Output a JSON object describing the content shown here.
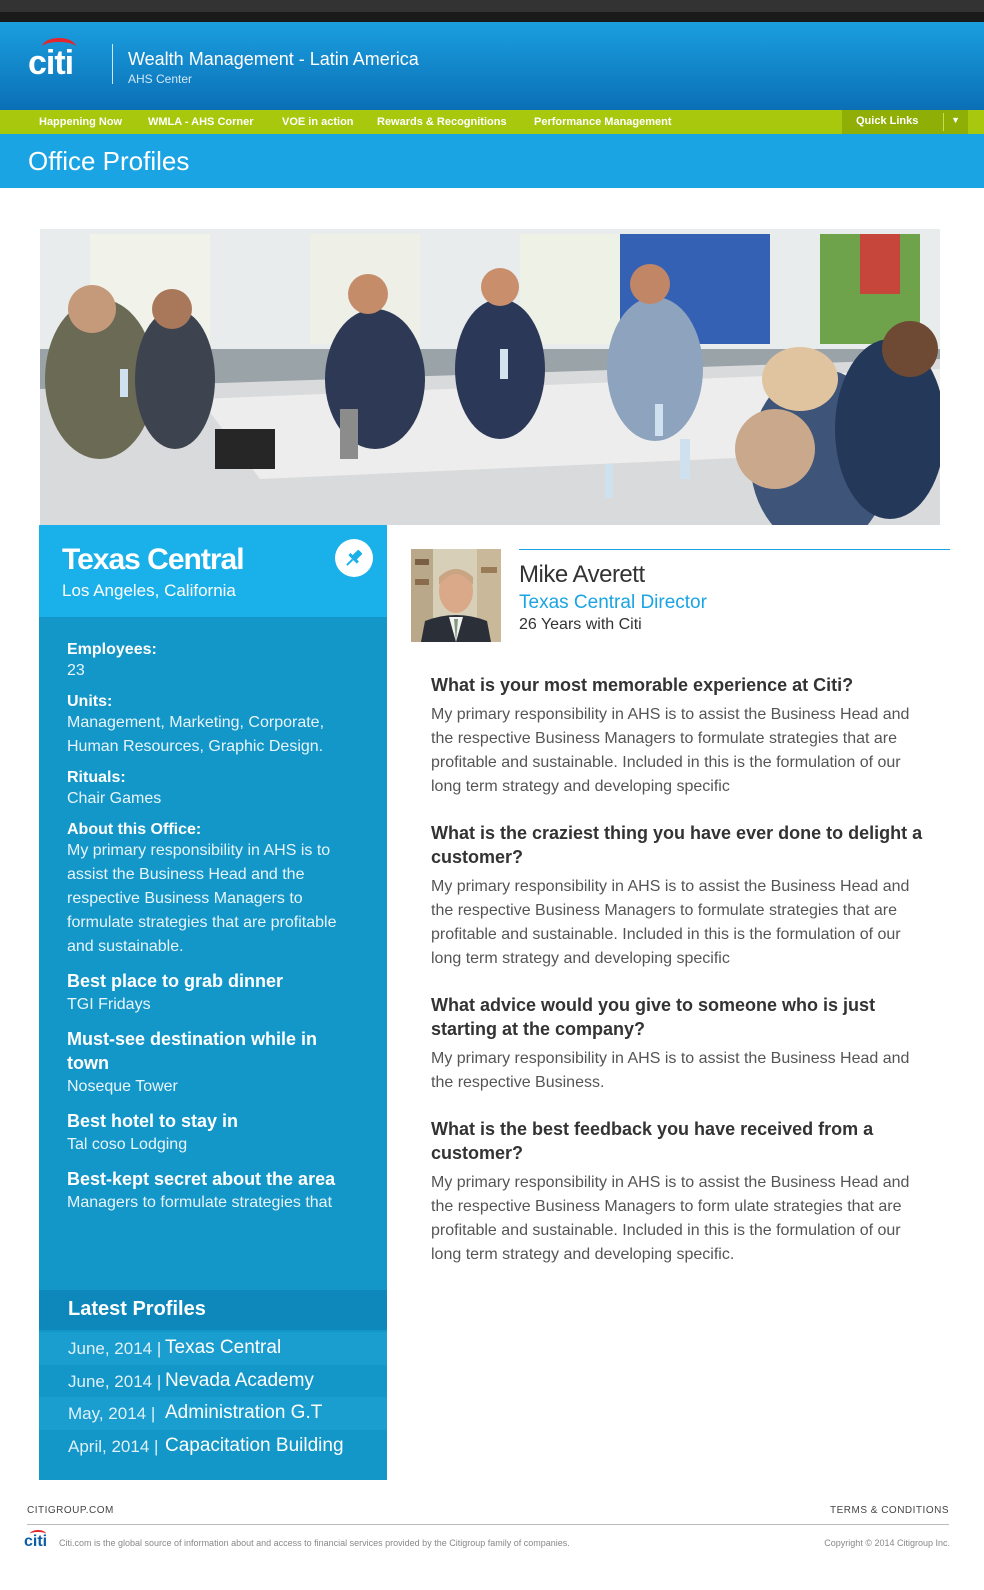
{
  "header": {
    "brand": "citi",
    "title": "Wealth Management - Latin America",
    "subtitle": "AHS Center"
  },
  "nav": {
    "items": [
      "Happening Now",
      "WMLA - AHS Corner",
      "VOE in action",
      "Rewards & Recognitions",
      "Performance Management"
    ],
    "quick_links": "Quick Links"
  },
  "page": {
    "title": "Office Profiles"
  },
  "office": {
    "name": "Texas Central",
    "location": "Los Angeles, California",
    "employees_label": "Employees:",
    "employees": "23",
    "units_label": "Units:",
    "units": "Management, Marketing, Corporate, Human Resources, Graphic Design.",
    "rituals_label": "Rituals:",
    "rituals": "Chair Games",
    "about_label": "About this Office:",
    "about": "My primary responsibility in AHS is to assist the Business Head and the respective Business Managers to formulate strategies that are profitable and sustainable.",
    "dinner_label": "Best place to grab dinner",
    "dinner": "TGI Fridays",
    "destination_label": "Must-see destination while in town",
    "destination": "Noseque Tower",
    "hotel_label": "Best hotel to stay in",
    "hotel": "Tal coso Lodging",
    "secret_label": "Best-kept secret about the area",
    "secret": "Managers to formulate strategies that"
  },
  "latest": {
    "title": "Latest Profiles",
    "items": [
      {
        "date": "June, 2014",
        "name": "Texas Central"
      },
      {
        "date": "June, 2014",
        "name": "Nevada Academy"
      },
      {
        "date": "May, 2014",
        "name": "Administration G.T"
      },
      {
        "date": "April, 2014",
        "name": "Capacitation Building"
      }
    ],
    "separator": "|"
  },
  "profile": {
    "name": "Mike Averett",
    "role": "Texas Central Director",
    "years": "26 Years with Citi"
  },
  "qa": [
    {
      "q": "What is your most memorable experience at Citi?",
      "a": "My primary responsibility in AHS is to assist the Business Head and the respective Business Managers to formulate strategies that are profitable and sustainable. Included in this is the formulation of our long term strategy and  developing specific"
    },
    {
      "q": "What is the craziest thing you have ever done to delight a customer?",
      "a": "My primary responsibility in AHS is to assist the Business Head and the respective Business Managers to formulate strategies that are profitable and sustainable. Included in this is the formulation of our long term strategy and  developing specific"
    },
    {
      "q": "What advice would you give to someone who is just starting at the company?",
      "a": "My primary responsibility in AHS is to assist the Business Head and the respective Business."
    },
    {
      "q": "What is the best feedback you have received from a customer?",
      "a": "My primary responsibility in AHS is to assist the Business Head and the respective Business Managers to form ulate strategies that are profitable and sustainable. Included in this is the formulation of our long term strategy and  developing specific."
    }
  ],
  "footer": {
    "left": "CITIGROUP.COM",
    "right": "TERMS & CONDITIONS",
    "logo": "citi",
    "text": "Citi.com is the global source of information about and access to financial services provided by the Citigroup family of companies.",
    "copyright": "Copyright © 2014 Citigroup Inc."
  },
  "colors": {
    "brand_blue": "#1aa4e3",
    "nav_green": "#a7c80d",
    "sidebar_blue": "#1396c8",
    "logo_red": "#e3262d"
  }
}
